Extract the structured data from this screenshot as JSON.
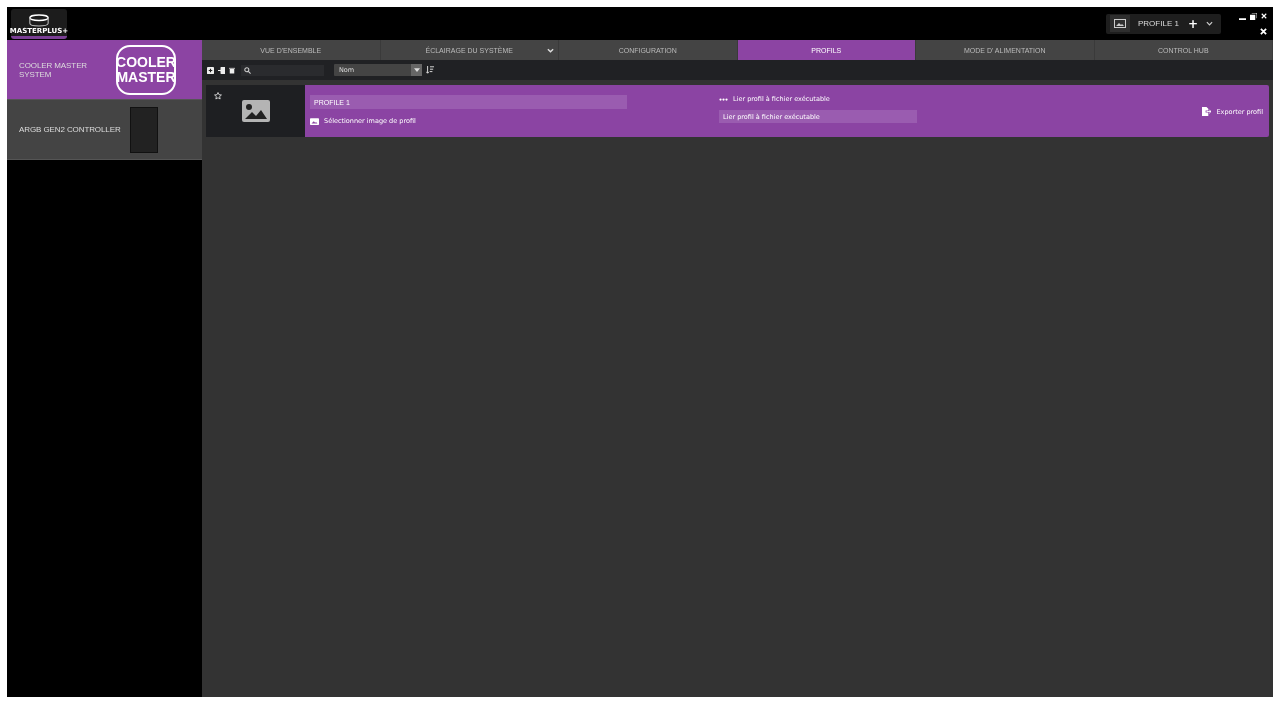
{
  "app": {
    "logo_caption": "MASTERPLUS+"
  },
  "profile_switcher": {
    "name": "PROFILE 1",
    "add": "+"
  },
  "sidebar": {
    "items": [
      {
        "name": "COOLER MASTER SYSTEM",
        "kind": "brand",
        "logo_lines": [
          "COOLER",
          "MASTER"
        ],
        "selected": true
      },
      {
        "name": "ARGB GEN2 CONTROLLER",
        "kind": "device",
        "selected": false
      }
    ]
  },
  "tabs": [
    {
      "label": "VUE D'ENSEMBLE",
      "selected": false,
      "dropdown": false
    },
    {
      "label": "ÉCLAIRAGE DU SYSTÈME",
      "selected": false,
      "dropdown": true
    },
    {
      "label": "CONFIGURATION",
      "selected": false,
      "dropdown": false
    },
    {
      "label": "PROFILS",
      "selected": true,
      "dropdown": false
    },
    {
      "label": "MODE D' ALIMENTATION",
      "selected": false,
      "dropdown": false
    },
    {
      "label": "CONTROL HUB",
      "selected": false,
      "dropdown": false
    }
  ],
  "toolbar": {
    "sort": "Nom"
  },
  "profiles": [
    {
      "name": "PROFILE 1",
      "favorite": false,
      "select_image": "Sélectionner image de profil",
      "link_label": "Lier profil à fichier exécutable",
      "link_placeholder": "Lier profil à fichier exécutable",
      "export": "Exporter profil"
    }
  ]
}
